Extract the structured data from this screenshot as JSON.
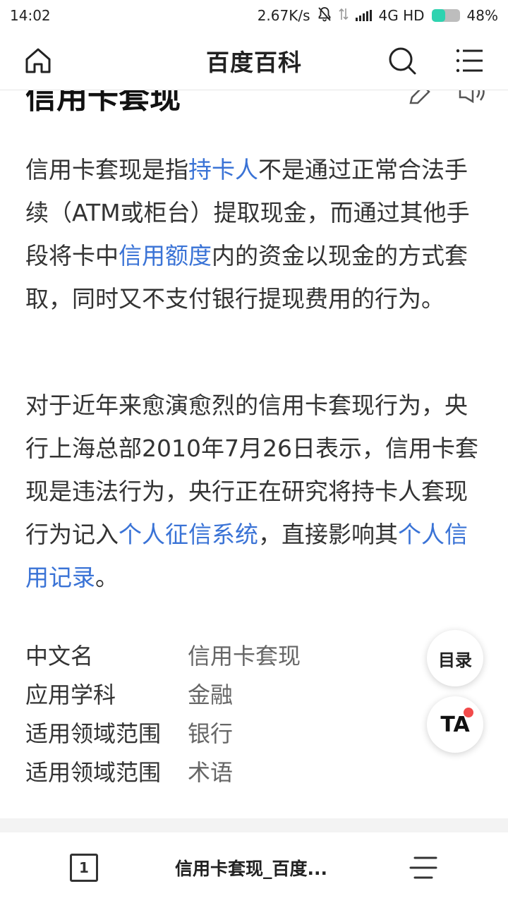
{
  "status_bar": {
    "time": "14:02",
    "net_speed": "2.67K/s",
    "network": "4G HD",
    "battery_text": "48%",
    "battery_level": 0.48,
    "battery_color": "#2ed3b0"
  },
  "nav": {
    "title": "百度百科",
    "icons": [
      "home-icon",
      "search-icon",
      "menu-icon"
    ]
  },
  "article": {
    "title": "信用卡套现",
    "para1": [
      {
        "text": "信用卡套现是指",
        "link": false
      },
      {
        "text": "持卡人",
        "link": true
      },
      {
        "text": "不是通过正常合法手续（ATM或柜台）提取现金，而通过其他手段将卡中",
        "link": false
      },
      {
        "text": "信用额度",
        "link": true
      },
      {
        "text": "内的资金以现金的方式套取，同时又不支付银行提现费用的行为。",
        "link": false
      }
    ],
    "para2": [
      {
        "text": "对于近年来愈演愈烈的信用卡套现行为，央行上海总部2010年7月26日表示，信用卡套现是违法行为，央行正在研究将持卡人套现行为记入",
        "link": false
      },
      {
        "text": "个人征信系统",
        "link": true
      },
      {
        "text": "，直接影响其",
        "link": false
      },
      {
        "text": "个人信用记录",
        "link": true
      },
      {
        "text": "。",
        "link": false
      }
    ],
    "link_color": "#3a73d6",
    "info": [
      {
        "key": "中文名",
        "value": "信用卡套现"
      },
      {
        "key": "应用学科",
        "value": "金融"
      },
      {
        "key": "适用领域范围",
        "value": "银行"
      },
      {
        "key": "适用领域范围",
        "value": "术语"
      }
    ]
  },
  "fabs": {
    "toc_label": "目录",
    "ta_label": "TA"
  },
  "bottom_bar": {
    "tab_count": "1",
    "tab_title": "信用卡套现_百度..."
  }
}
